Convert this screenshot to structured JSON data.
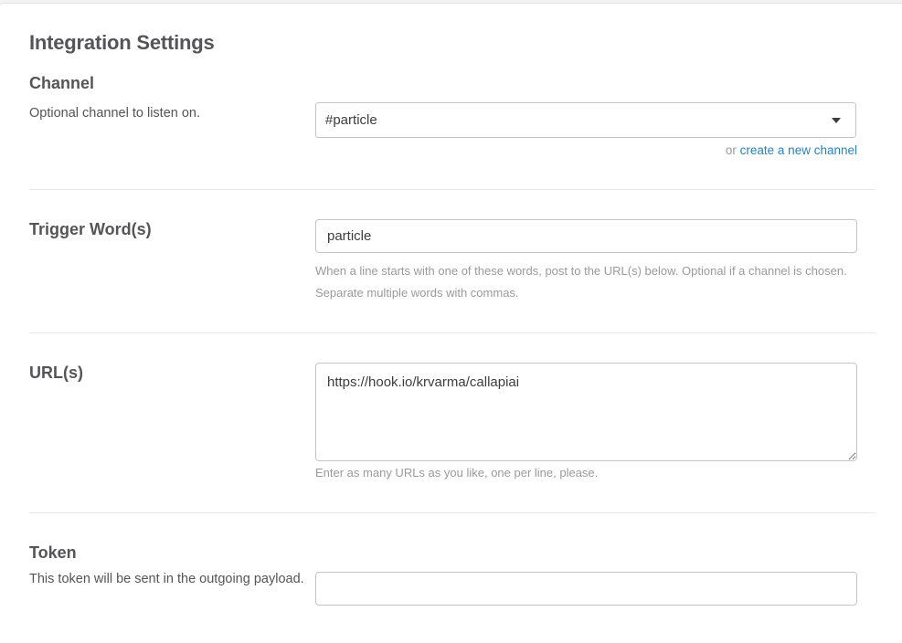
{
  "page": {
    "title": "Integration Settings"
  },
  "channel": {
    "label": "Channel",
    "description": "Optional channel to listen on.",
    "selected": "#particle",
    "hint_prefix": "or ",
    "hint_link": "create a new channel"
  },
  "trigger": {
    "label": "Trigger Word(s)",
    "value": "particle",
    "help": "When a line starts with one of these words, post to the URL(s) below. Optional if a channel is chosen. Separate multiple words with commas."
  },
  "urls": {
    "label": "URL(s)",
    "value": "https://hook.io/krvarma/callapiai",
    "help": "Enter as many URLs as you like, one per line, please."
  },
  "token": {
    "label": "Token",
    "description": "This token will be sent in the outgoing payload."
  },
  "icons": {
    "select_caret": "caret-down-icon"
  }
}
